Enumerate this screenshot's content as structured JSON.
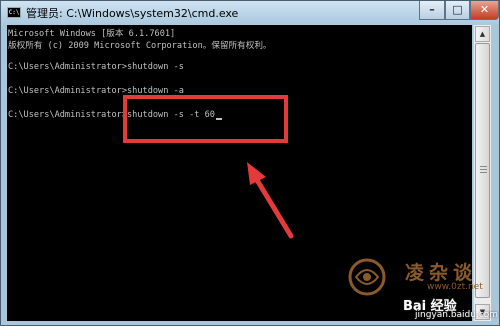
{
  "window": {
    "title": "管理员: C:\\Windows\\system32\\cmd.exe",
    "icon_label": "C:\\",
    "controls": {
      "minimize": "–",
      "maximize": "□",
      "close": "✕"
    }
  },
  "console": {
    "lines": [
      "Microsoft Windows [版本 6.1.7601]",
      "版权所有 (c) 2009 Microsoft Corporation。保留所有权利。",
      "",
      "C:\\Users\\Administrator>shutdown -s",
      "",
      "C:\\Users\\Administrator>shutdown -a",
      "",
      "C:\\Users\\Administrator>shutdown -s -t 60"
    ]
  },
  "scrollbar": {
    "up": "▲",
    "down": "▼"
  },
  "watermark": {
    "site_name": "凌杂谈",
    "site_url": "www.0zt.net",
    "baidu_brand": "Bai 经验",
    "baidu_url": "jingyan.baidu.com"
  },
  "colors": {
    "console_bg": "#000000",
    "console_text": "#c0c0c0",
    "annotation_red": "#e53a3a"
  }
}
